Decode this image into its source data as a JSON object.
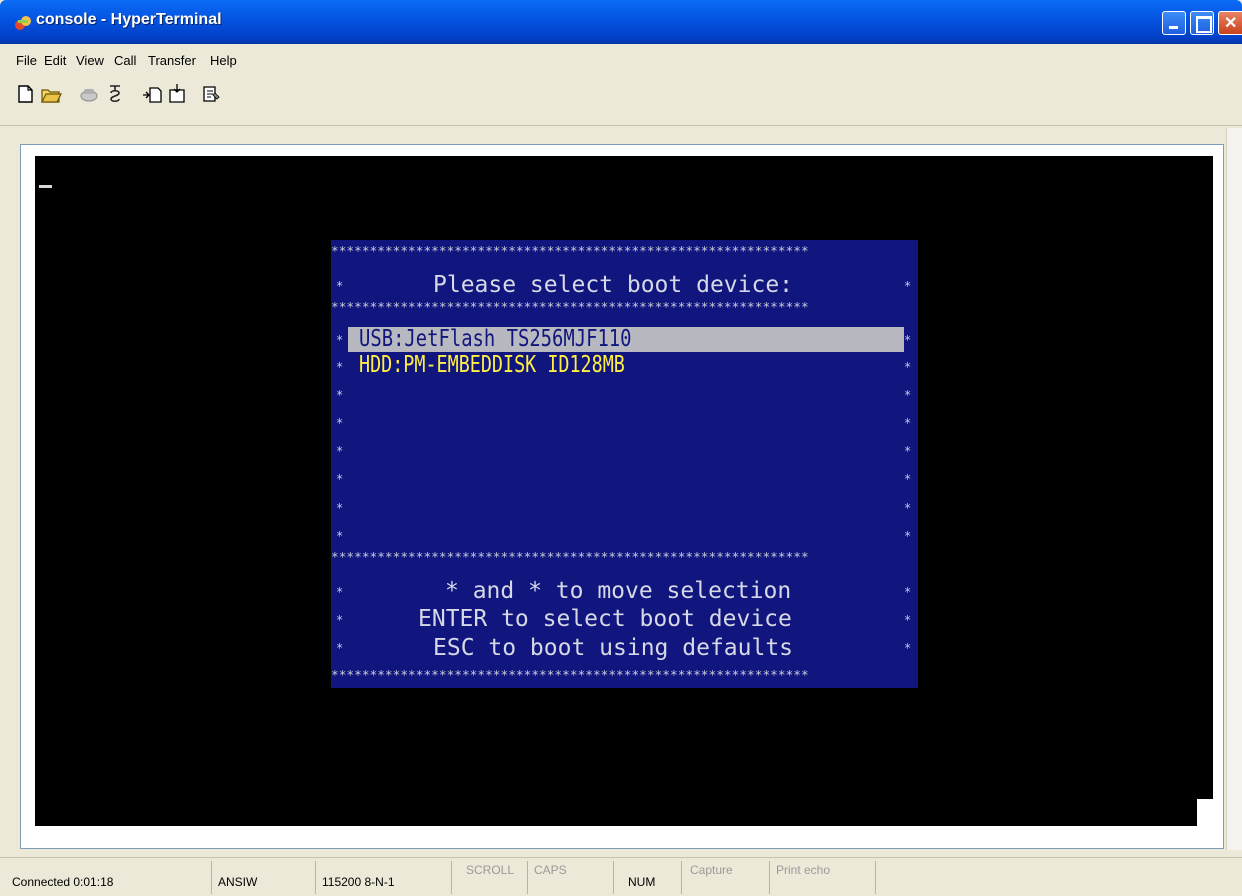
{
  "window": {
    "title": "console - HyperTerminal"
  },
  "menu": {
    "items": [
      "File",
      "Edit",
      "View",
      "Call",
      "Transfer",
      "Help"
    ]
  },
  "toolbar": {
    "icons": [
      "new-icon",
      "open-icon",
      "call-icon",
      "disconnect-icon",
      "send-icon",
      "receive-icon",
      "properties-icon"
    ]
  },
  "boot_menu": {
    "border_row": "**************************************************************",
    "side_char": "*",
    "title": "Please select boot device:",
    "options": [
      {
        "label": "USB:JetFlash TS256MJF110",
        "selected": true
      },
      {
        "label": "HDD:PM-EMBEDDISK ID128MB",
        "selected": false
      }
    ],
    "help": [
      "* and * to move selection",
      "ENTER to select boot device",
      "ESC to boot using defaults"
    ]
  },
  "status": {
    "connected": "Connected 0:01:18",
    "emulation": "ANSIW",
    "port_settings": "115200 8-N-1",
    "scroll": "SCROLL",
    "caps": "CAPS",
    "num": "NUM",
    "capture": "Capture",
    "print_echo": "Print echo"
  },
  "colors": {
    "titlebar": "#0453e0",
    "menu_background": "#10167e",
    "menu_text": "#d6d8e6",
    "selected_bar": "#b8b8c0",
    "option_text": "#ffee44",
    "terminal_background": "#000000"
  }
}
